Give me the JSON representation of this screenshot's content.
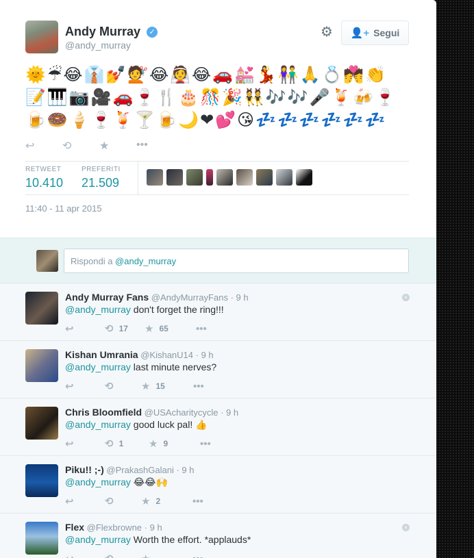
{
  "tweet": {
    "author_name": "Andy Murray",
    "verified_glyph": "✓",
    "author_handle": "@andy_murray",
    "follow_label": "Segui",
    "follow_icon": "👤+",
    "settings_icon": "⚙",
    "emoji_text": "🌞☔😂👔💅💇😂👰😂🚗💒💃👫🙏💍💏👏📝🎹📷🎥🚗🍷🍴🎂🎊🎉👯🎶🎶🎤🍹🍻🍷🍺🍩🍦🍷🍹🍸🍺🌙❤💕😘💤💤💤💤💤💤",
    "actions": {
      "reply_icon": "↩",
      "retweet_icon": "⟲",
      "favorite_icon": "★",
      "more_icon": "•••"
    },
    "retweet_label": "RETWEET",
    "retweet_count": "10.410",
    "favorites_label": "PREFERITI",
    "favorites_count": "21.509",
    "timestamp": "11:40 - 11 apr 2015"
  },
  "reply_box": {
    "placeholder_prefix": "Rispondi a ",
    "placeholder_mention": "@andy_murray"
  },
  "replies": [
    {
      "name": "Andy Murray Fans",
      "handle": "@AndyMurrayFans",
      "time": "· 9 h",
      "mention": "@andy_murray",
      "text": " don't forget the ring!!!",
      "retweets": "17",
      "favorites": "65"
    },
    {
      "name": "Kishan Umrania",
      "handle": "@KishanU14",
      "time": "· 9 h",
      "mention": "@andy_murray",
      "text": " last minute nerves?",
      "retweets": "",
      "favorites": "15"
    },
    {
      "name": "Chris Bloomfield",
      "handle": "@USAcharitycycle",
      "time": "· 9 h",
      "mention": "@andy_murray",
      "text": " good luck pal! 👍",
      "retweets": "1",
      "favorites": "9"
    },
    {
      "name": "Piku!! ;-)",
      "handle": "@PrakashGalani",
      "time": "· 9 h",
      "mention": "@andy_murray",
      "text": " 😂😂🙌",
      "retweets": "",
      "favorites": "2"
    },
    {
      "name": "Flex",
      "handle": "@Flexbrowne",
      "time": "· 9 h",
      "mention": "@andy_murray",
      "text": " Worth the effort. *applauds*",
      "retweets": "",
      "favorites": ""
    }
  ],
  "reply_actions": {
    "reply_icon": "↩",
    "retweet_icon": "⟲",
    "favorite_icon": "★",
    "more_icon": "•••",
    "close_icon": "×"
  },
  "colors": {
    "link": "#1b95a0",
    "accent": "#55acee",
    "muted": "#8899a6",
    "text": "#292f33"
  }
}
